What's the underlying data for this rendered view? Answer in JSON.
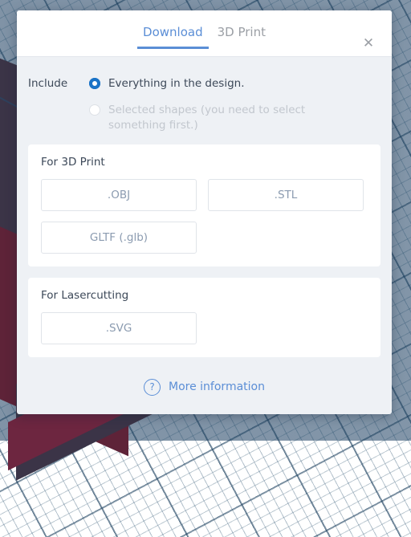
{
  "background": {
    "scene_name": "3d-workplane",
    "grid_color": "#8295a8",
    "object_color": "#5e2338"
  },
  "modal": {
    "tabs": [
      {
        "label": "Download",
        "active": true,
        "name": "tab-download"
      },
      {
        "label": "3D Print",
        "active": false,
        "name": "tab-3d-print"
      }
    ],
    "close_label": "✕",
    "include": {
      "label": "Include",
      "options": [
        {
          "label": "Everything in the design.",
          "checked": true,
          "disabled": false
        },
        {
          "label": "Selected shapes (you need to select something first.)",
          "checked": false,
          "disabled": true
        }
      ]
    },
    "sections": [
      {
        "title": "For 3D Print",
        "buttons": [
          ".OBJ",
          ".STL",
          "GLTF (.glb)"
        ]
      },
      {
        "title": "For Lasercutting",
        "buttons": [
          ".SVG"
        ]
      }
    ],
    "footer": {
      "icon": "question-mark-circle-icon",
      "link_label": "More information"
    },
    "accent_color": "#5b8ed6",
    "radio_color": "#1a73c7"
  }
}
